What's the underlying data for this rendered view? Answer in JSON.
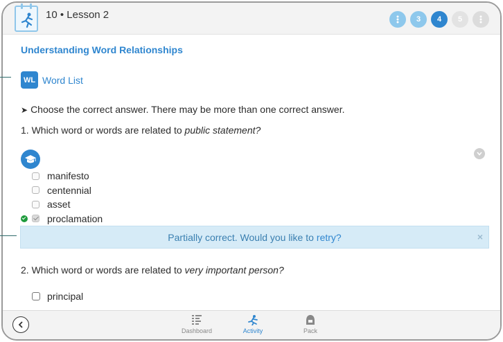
{
  "header": {
    "lesson_title": "10 • Lesson 2",
    "steps": [
      {
        "label": "",
        "state": "dots-done"
      },
      {
        "label": "3",
        "state": "done"
      },
      {
        "label": "4",
        "state": "current"
      },
      {
        "label": "5",
        "state": "future"
      },
      {
        "label": "",
        "state": "dots-future"
      }
    ]
  },
  "main": {
    "section_title": "Understanding Word Relationships",
    "word_list": {
      "badge": "WL",
      "label": "Word List"
    },
    "instruction": "Choose the correct answer. There may be more than one correct answer.",
    "question1": {
      "prefix": "1. Which word or words are related to ",
      "term": "public statement?",
      "options": [
        {
          "label": "manifesto",
          "checked": false,
          "correct": false
        },
        {
          "label": "centennial",
          "checked": false,
          "correct": false
        },
        {
          "label": "asset",
          "checked": false,
          "correct": false
        },
        {
          "label": "proclamation",
          "checked": true,
          "correct": true
        }
      ]
    },
    "feedback": {
      "text": "Partially correct. Would you like to",
      "retry": "retry?",
      "close": "×"
    },
    "question2": {
      "prefix": "2. Which word or words are related to ",
      "term": "very important person?",
      "options": [
        {
          "label": "principal",
          "checked": false
        }
      ]
    }
  },
  "bottom_nav": {
    "items": [
      {
        "label": "Dashboard",
        "icon": "dashboard-icon",
        "active": false
      },
      {
        "label": "Activity",
        "icon": "activity-icon",
        "active": true
      },
      {
        "label": "Pack",
        "icon": "pack-icon",
        "active": false
      }
    ]
  },
  "colors": {
    "accent": "#2f86cf",
    "step_done": "#8ec8ec",
    "correct": "#1e9b3c",
    "feedback_bg": "#d6ebf7"
  }
}
